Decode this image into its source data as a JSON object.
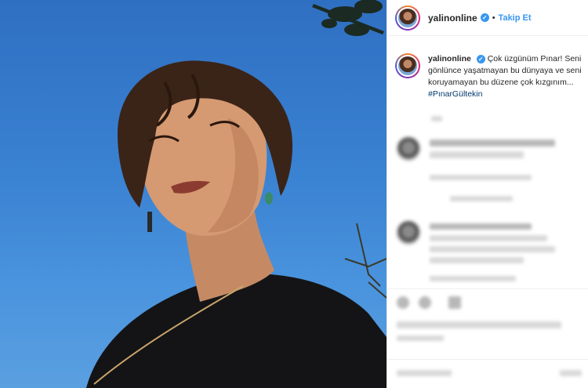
{
  "post": {
    "username": "yalinonline",
    "verified_mark": "✓",
    "dot": "•",
    "follow_label": "Takip Et"
  },
  "caption": {
    "username": "yalinonline",
    "text": "Çok üzgünüm Pınar! Seni gönlünce yaşatmayan bu dünyaya ve seni koruyamayan bu düzene çok kızgınım...",
    "hashtag": "#PınarGültekin"
  },
  "icons": [
    "verified-badge-icon",
    "heart-icon",
    "comment-icon",
    "share-icon"
  ],
  "colors": {
    "link": "#3897f0",
    "hashtag": "#00376b",
    "sky": "#3a82d2"
  }
}
